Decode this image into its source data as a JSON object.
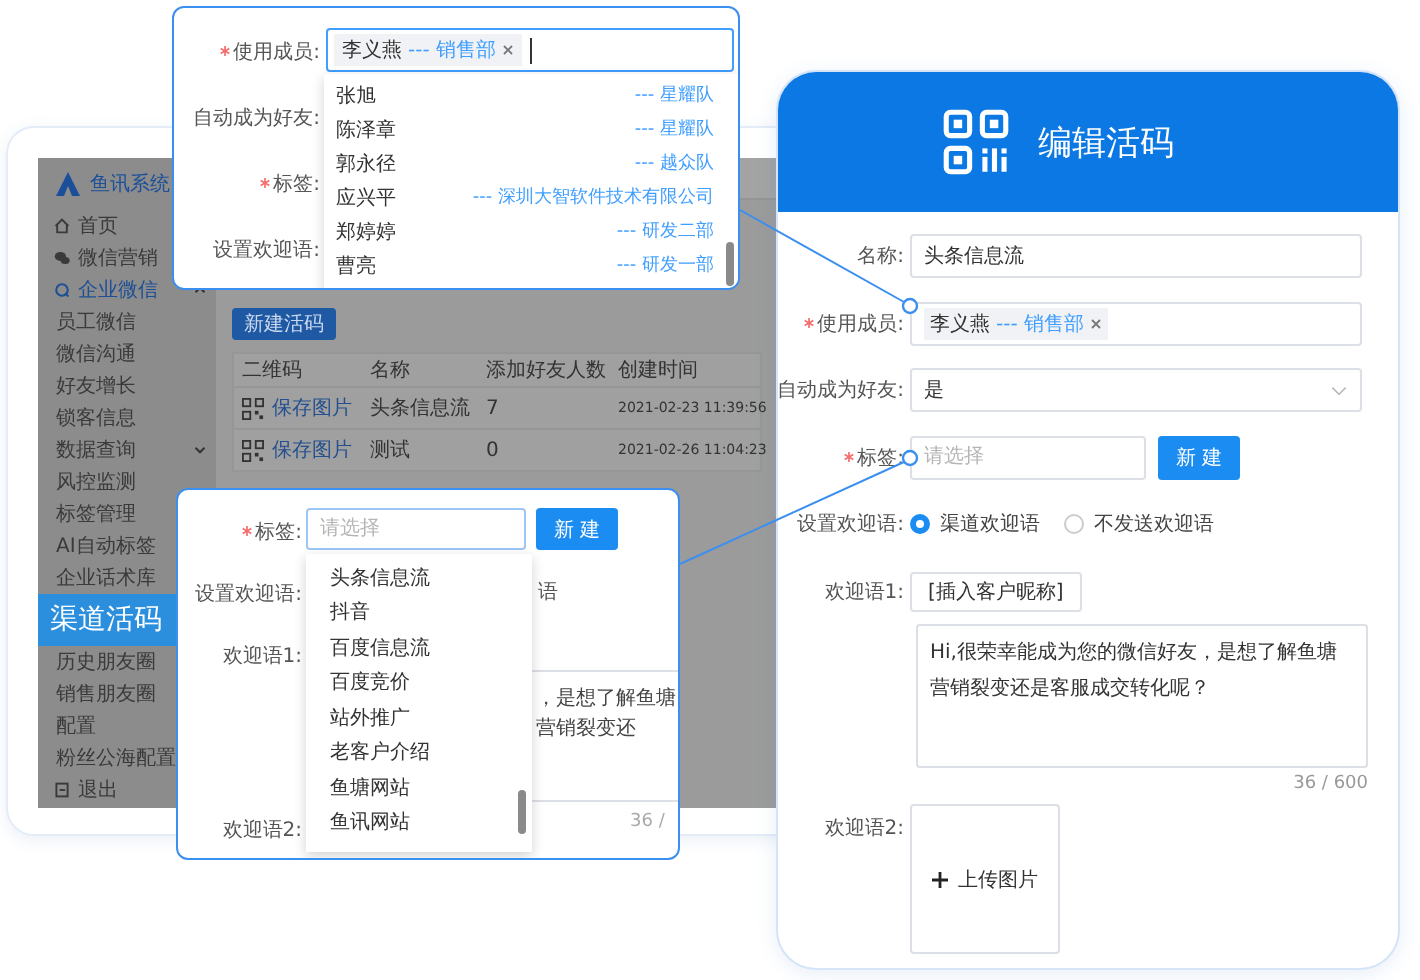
{
  "app": {
    "logo": "鱼讯系统",
    "sidebar": {
      "items": [
        {
          "label": "首页",
          "selected": false
        },
        {
          "label": "微信营销",
          "selected": false
        },
        {
          "label": "企业微信",
          "selected": true,
          "expanded": true,
          "children": [
            {
              "label": "员工微信",
              "selected": false
            },
            {
              "label": "微信沟通",
              "selected": false
            },
            {
              "label": "好友增长",
              "selected": false
            },
            {
              "label": "锁客信息",
              "selected": false
            },
            {
              "label": "数据查询",
              "selected": false,
              "expanded": false
            },
            {
              "label": "风控监测",
              "selected": false
            },
            {
              "label": "标签管理",
              "selected": false
            },
            {
              "label": "AI自动标签",
              "selected": false
            },
            {
              "label": "企业话术库",
              "selected": false
            },
            {
              "label": "渠道活码",
              "selected": true
            },
            {
              "label": "历史朋友圈",
              "selected": false
            },
            {
              "label": "销售朋友圈",
              "selected": false
            },
            {
              "label": "配置",
              "selected": false
            },
            {
              "label": "粉丝公海配置",
              "selected": false
            }
          ]
        },
        {
          "label": "退出",
          "selected": false
        }
      ]
    },
    "new_button": "新建活码",
    "table": {
      "columns": [
        "二维码",
        "名称",
        "添加好友人数",
        "创建时间"
      ],
      "rows": [
        {
          "action": "保存图片",
          "name": "头条信息流",
          "friends": "7",
          "created": "2021-02-23 11:39:56"
        },
        {
          "action": "保存图片",
          "name": "测试",
          "friends": "0",
          "created": "2021-02-26 11:04:23"
        }
      ]
    }
  },
  "member_popup": {
    "labels": [
      {
        "text": "使用成员:",
        "required": true
      },
      {
        "text": "自动成为好友:",
        "required": false
      },
      {
        "text": "标签:",
        "required": true
      },
      {
        "text": "设置欢迎语:",
        "required": false
      }
    ],
    "member": {
      "name": "李义燕",
      "dept": "--- 销售部"
    },
    "options": [
      {
        "name": "张旭",
        "dept": "--- 星耀队"
      },
      {
        "name": "陈泽章",
        "dept": "--- 星耀队"
      },
      {
        "name": "郭永径",
        "dept": "--- 越众队"
      },
      {
        "name": "应兴平",
        "dept": "--- 深圳大智软件技术有限公司"
      },
      {
        "name": "郑婷婷",
        "dept": "--- 研发二部"
      },
      {
        "name": "曹亮",
        "dept": "--- 研发一部"
      }
    ]
  },
  "tag_popup": {
    "labels": [
      {
        "text": "标签:",
        "required": true
      },
      {
        "text": "设置欢迎语:",
        "required": false
      },
      {
        "text": "欢迎语1:",
        "required": false
      },
      {
        "text": "欢迎语2:",
        "required": false
      }
    ],
    "placeholder": "请选择",
    "button": "新建",
    "options": [
      "头条信息流",
      "抖音",
      "百度信息流",
      "百度竞价",
      "站外推广",
      "老客户介绍",
      "鱼塘网站",
      "鱼讯网站"
    ],
    "option_fragment": "语",
    "text_fragment": "，是想了解鱼塘营销裂变还",
    "counter_fragment": "36 /"
  },
  "editor": {
    "title": "编辑活码",
    "name": {
      "label": "名称:",
      "value": "头条信息流"
    },
    "members": {
      "label": "使用成员:",
      "required": true,
      "name": "李义燕",
      "dept": "--- 销售部"
    },
    "auto_friend": {
      "label": "自动成为好友:",
      "value": "是"
    },
    "tags": {
      "label": "标签:",
      "required": true,
      "placeholder": "请选择",
      "button": "新建"
    },
    "welcome": {
      "label": "设置欢迎语:",
      "options": [
        {
          "label": "渠道欢迎语",
          "selected": true
        },
        {
          "label": "不发送欢迎语",
          "selected": false
        }
      ]
    },
    "welcome_1": {
      "label": "欢迎语1:",
      "insert_button": "[插入客户昵称]",
      "text": "Hi,很荣幸能成为您的微信好友，是想了解鱼塘营销裂变还是客服成交转化呢？",
      "counter": "36 / 600"
    },
    "welcome_2": {
      "label": "欢迎语2:",
      "upload": "上传图片"
    }
  }
}
